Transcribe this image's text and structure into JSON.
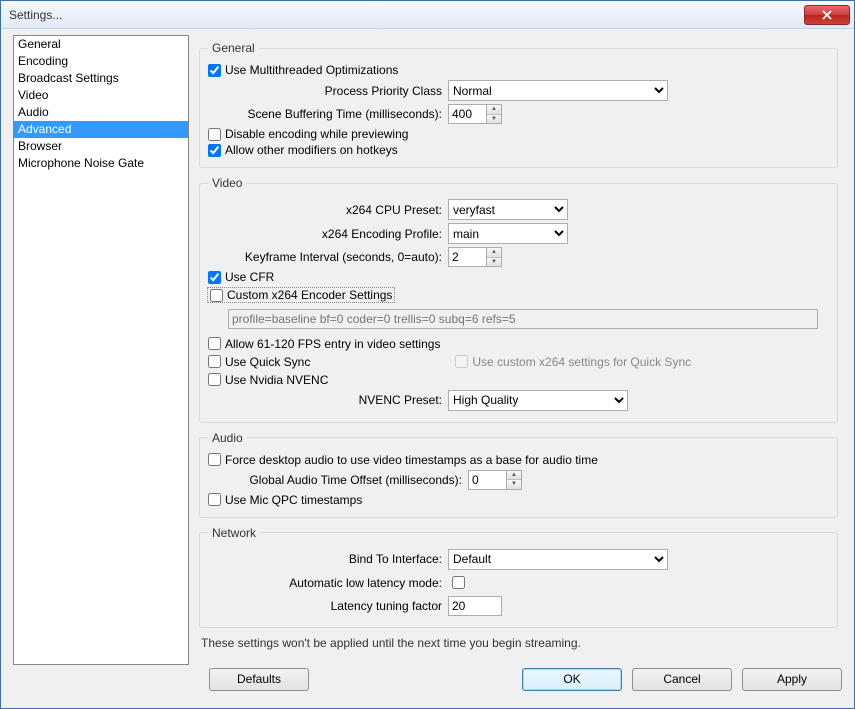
{
  "window": {
    "title": "Settings..."
  },
  "sidebar": {
    "items": [
      {
        "label": "General"
      },
      {
        "label": "Encoding"
      },
      {
        "label": "Broadcast Settings"
      },
      {
        "label": "Video"
      },
      {
        "label": "Audio"
      },
      {
        "label": "Advanced",
        "selected": true
      },
      {
        "label": "Browser"
      },
      {
        "label": "Microphone Noise Gate"
      }
    ]
  },
  "general": {
    "legend": "General",
    "multithreaded": "Use Multithreaded Optimizations",
    "priority_label": "Process Priority Class",
    "priority_value": "Normal",
    "scene_buffer_label": "Scene Buffering Time (milliseconds):",
    "scene_buffer_value": "400",
    "disable_encoding": "Disable encoding while previewing",
    "allow_modifiers": "Allow other modifiers on hotkeys"
  },
  "video": {
    "legend": "Video",
    "cpu_preset_label": "x264 CPU Preset:",
    "cpu_preset_value": "veryfast",
    "encoding_profile_label": "x264 Encoding Profile:",
    "encoding_profile_value": "main",
    "keyframe_label": "Keyframe Interval (seconds, 0=auto):",
    "keyframe_value": "2",
    "use_cfr": "Use CFR",
    "custom_settings_label": "Custom x264 Encoder Settings",
    "custom_settings_placeholder": "profile=baseline bf=0 coder=0 trellis=0 subq=6 refs=5",
    "allow_61_120": "Allow 61-120 FPS entry in video settings",
    "use_quick_sync": "Use Quick Sync",
    "use_custom_qs": "Use custom x264 settings for Quick Sync",
    "use_nvenc": "Use Nvidia NVENC",
    "nvenc_preset_label": "NVENC Preset:",
    "nvenc_preset_value": "High Quality"
  },
  "audio": {
    "legend": "Audio",
    "force_desktop": "Force desktop audio to use video timestamps as a base for audio time",
    "global_offset_label": "Global Audio Time Offset (milliseconds):",
    "global_offset_value": "0",
    "use_mic_qpc": "Use Mic QPC timestamps"
  },
  "network": {
    "legend": "Network",
    "bind_label": "Bind To Interface:",
    "bind_value": "Default",
    "auto_low_latency": "Automatic low latency mode:",
    "latency_factor_label": "Latency tuning factor",
    "latency_factor_value": "20"
  },
  "note": "These settings won't be applied until the next time you begin streaming.",
  "buttons": {
    "defaults": "Defaults",
    "ok": "OK",
    "cancel": "Cancel",
    "apply": "Apply"
  }
}
